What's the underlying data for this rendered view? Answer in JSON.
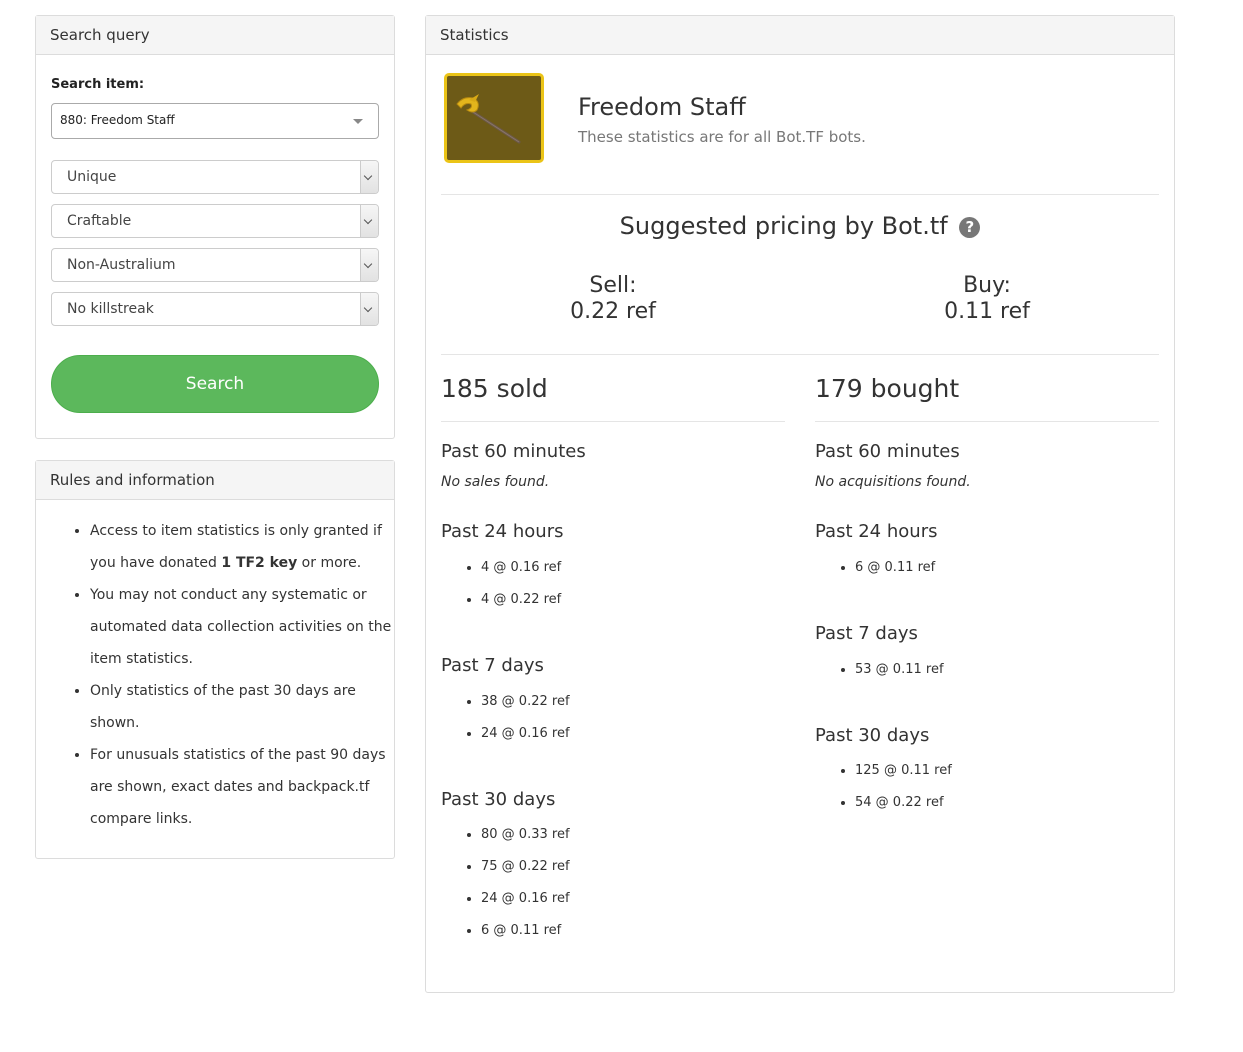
{
  "search_panel": {
    "title": "Search query",
    "item_label": "Search item:",
    "item_value": "880: Freedom Staff",
    "quality": "Unique",
    "craftable": "Craftable",
    "australium": "Non-Australium",
    "killstreak": "No killstreak",
    "search_button": "Search"
  },
  "rules_panel": {
    "title": "Rules and information",
    "rules": {
      "r1_pre": "Access to item statistics is only granted if you have donated ",
      "r1_bold": "1 TF2 key",
      "r1_post": " or more.",
      "r2": "You may not conduct any systematic or automated data collection activities on the item statistics.",
      "r3": "Only statistics of the past 30 days are shown.",
      "r4": "For unusuals statistics of the past 90 days are shown, exact dates and backpack.tf compare links."
    }
  },
  "stats": {
    "title": "Statistics",
    "item_name": "Freedom Staff",
    "item_subtitle": "These statistics are for all Bot.TF bots.",
    "item_border_color": "#ebc417",
    "suggested_title": "Suggested pricing by Bot.tf",
    "help_icon": "?",
    "sell_label": "Sell:",
    "sell_value": "0.22 ref",
    "buy_label": "Buy:",
    "buy_value": "0.11 ref",
    "sold": {
      "count": "185 sold",
      "p60_label": "Past 60 minutes",
      "p60_empty": "No sales found.",
      "p24_label": "Past 24 hours",
      "p24": [
        "4 @ 0.16 ref",
        "4 @ 0.22 ref"
      ],
      "p7_label": "Past 7 days",
      "p7": [
        "38 @ 0.22 ref",
        "24 @ 0.16 ref"
      ],
      "p30_label": "Past 30 days",
      "p30": [
        "80 @ 0.33 ref",
        "75 @ 0.22 ref",
        "24 @ 0.16 ref",
        "6 @ 0.11 ref"
      ]
    },
    "bought": {
      "count": "179 bought",
      "p60_label": "Past 60 minutes",
      "p60_empty": "No acquisitions found.",
      "p24_label": "Past 24 hours",
      "p24": [
        "6 @ 0.11 ref"
      ],
      "p7_label": "Past 7 days",
      "p7": [
        "53 @ 0.11 ref"
      ],
      "p30_label": "Past 30 days",
      "p30": [
        "125 @ 0.11 ref",
        "54 @ 0.22 ref"
      ]
    }
  }
}
